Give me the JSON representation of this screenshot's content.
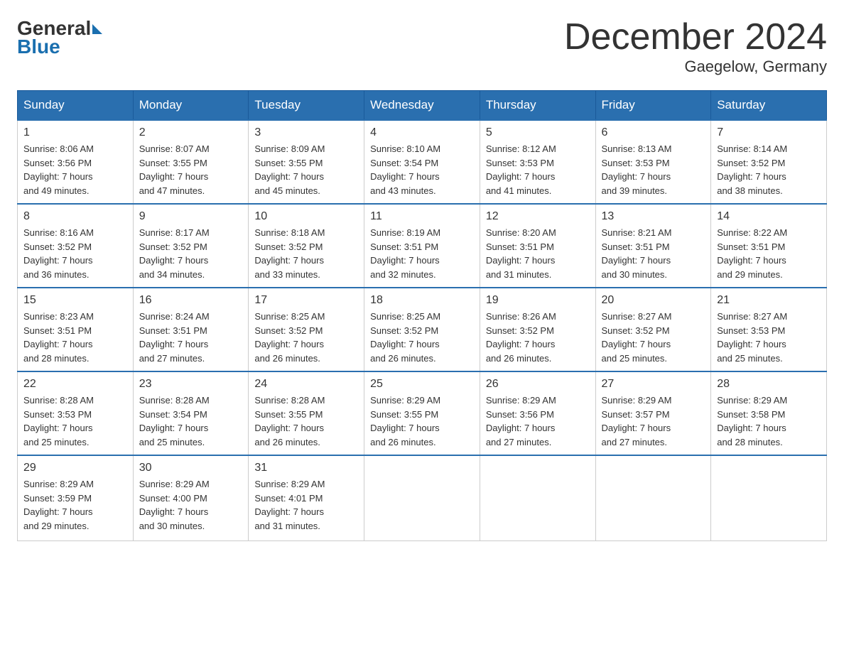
{
  "header": {
    "logo": {
      "general": "General",
      "blue": "Blue"
    },
    "title": "December 2024",
    "location": "Gaegelow, Germany"
  },
  "days_of_week": [
    "Sunday",
    "Monday",
    "Tuesday",
    "Wednesday",
    "Thursday",
    "Friday",
    "Saturday"
  ],
  "weeks": [
    [
      {
        "day": "1",
        "sunrise": "8:06 AM",
        "sunset": "3:56 PM",
        "daylight": "7 hours and 49 minutes."
      },
      {
        "day": "2",
        "sunrise": "8:07 AM",
        "sunset": "3:55 PM",
        "daylight": "7 hours and 47 minutes."
      },
      {
        "day": "3",
        "sunrise": "8:09 AM",
        "sunset": "3:55 PM",
        "daylight": "7 hours and 45 minutes."
      },
      {
        "day": "4",
        "sunrise": "8:10 AM",
        "sunset": "3:54 PM",
        "daylight": "7 hours and 43 minutes."
      },
      {
        "day": "5",
        "sunrise": "8:12 AM",
        "sunset": "3:53 PM",
        "daylight": "7 hours and 41 minutes."
      },
      {
        "day": "6",
        "sunrise": "8:13 AM",
        "sunset": "3:53 PM",
        "daylight": "7 hours and 39 minutes."
      },
      {
        "day": "7",
        "sunrise": "8:14 AM",
        "sunset": "3:52 PM",
        "daylight": "7 hours and 38 minutes."
      }
    ],
    [
      {
        "day": "8",
        "sunrise": "8:16 AM",
        "sunset": "3:52 PM",
        "daylight": "7 hours and 36 minutes."
      },
      {
        "day": "9",
        "sunrise": "8:17 AM",
        "sunset": "3:52 PM",
        "daylight": "7 hours and 34 minutes."
      },
      {
        "day": "10",
        "sunrise": "8:18 AM",
        "sunset": "3:52 PM",
        "daylight": "7 hours and 33 minutes."
      },
      {
        "day": "11",
        "sunrise": "8:19 AM",
        "sunset": "3:51 PM",
        "daylight": "7 hours and 32 minutes."
      },
      {
        "day": "12",
        "sunrise": "8:20 AM",
        "sunset": "3:51 PM",
        "daylight": "7 hours and 31 minutes."
      },
      {
        "day": "13",
        "sunrise": "8:21 AM",
        "sunset": "3:51 PM",
        "daylight": "7 hours and 30 minutes."
      },
      {
        "day": "14",
        "sunrise": "8:22 AM",
        "sunset": "3:51 PM",
        "daylight": "7 hours and 29 minutes."
      }
    ],
    [
      {
        "day": "15",
        "sunrise": "8:23 AM",
        "sunset": "3:51 PM",
        "daylight": "7 hours and 28 minutes."
      },
      {
        "day": "16",
        "sunrise": "8:24 AM",
        "sunset": "3:51 PM",
        "daylight": "7 hours and 27 minutes."
      },
      {
        "day": "17",
        "sunrise": "8:25 AM",
        "sunset": "3:52 PM",
        "daylight": "7 hours and 26 minutes."
      },
      {
        "day": "18",
        "sunrise": "8:25 AM",
        "sunset": "3:52 PM",
        "daylight": "7 hours and 26 minutes."
      },
      {
        "day": "19",
        "sunrise": "8:26 AM",
        "sunset": "3:52 PM",
        "daylight": "7 hours and 26 minutes."
      },
      {
        "day": "20",
        "sunrise": "8:27 AM",
        "sunset": "3:52 PM",
        "daylight": "7 hours and 25 minutes."
      },
      {
        "day": "21",
        "sunrise": "8:27 AM",
        "sunset": "3:53 PM",
        "daylight": "7 hours and 25 minutes."
      }
    ],
    [
      {
        "day": "22",
        "sunrise": "8:28 AM",
        "sunset": "3:53 PM",
        "daylight": "7 hours and 25 minutes."
      },
      {
        "day": "23",
        "sunrise": "8:28 AM",
        "sunset": "3:54 PM",
        "daylight": "7 hours and 25 minutes."
      },
      {
        "day": "24",
        "sunrise": "8:28 AM",
        "sunset": "3:55 PM",
        "daylight": "7 hours and 26 minutes."
      },
      {
        "day": "25",
        "sunrise": "8:29 AM",
        "sunset": "3:55 PM",
        "daylight": "7 hours and 26 minutes."
      },
      {
        "day": "26",
        "sunrise": "8:29 AM",
        "sunset": "3:56 PM",
        "daylight": "7 hours and 27 minutes."
      },
      {
        "day": "27",
        "sunrise": "8:29 AM",
        "sunset": "3:57 PM",
        "daylight": "7 hours and 27 minutes."
      },
      {
        "day": "28",
        "sunrise": "8:29 AM",
        "sunset": "3:58 PM",
        "daylight": "7 hours and 28 minutes."
      }
    ],
    [
      {
        "day": "29",
        "sunrise": "8:29 AM",
        "sunset": "3:59 PM",
        "daylight": "7 hours and 29 minutes."
      },
      {
        "day": "30",
        "sunrise": "8:29 AM",
        "sunset": "4:00 PM",
        "daylight": "7 hours and 30 minutes."
      },
      {
        "day": "31",
        "sunrise": "8:29 AM",
        "sunset": "4:01 PM",
        "daylight": "7 hours and 31 minutes."
      },
      null,
      null,
      null,
      null
    ]
  ]
}
